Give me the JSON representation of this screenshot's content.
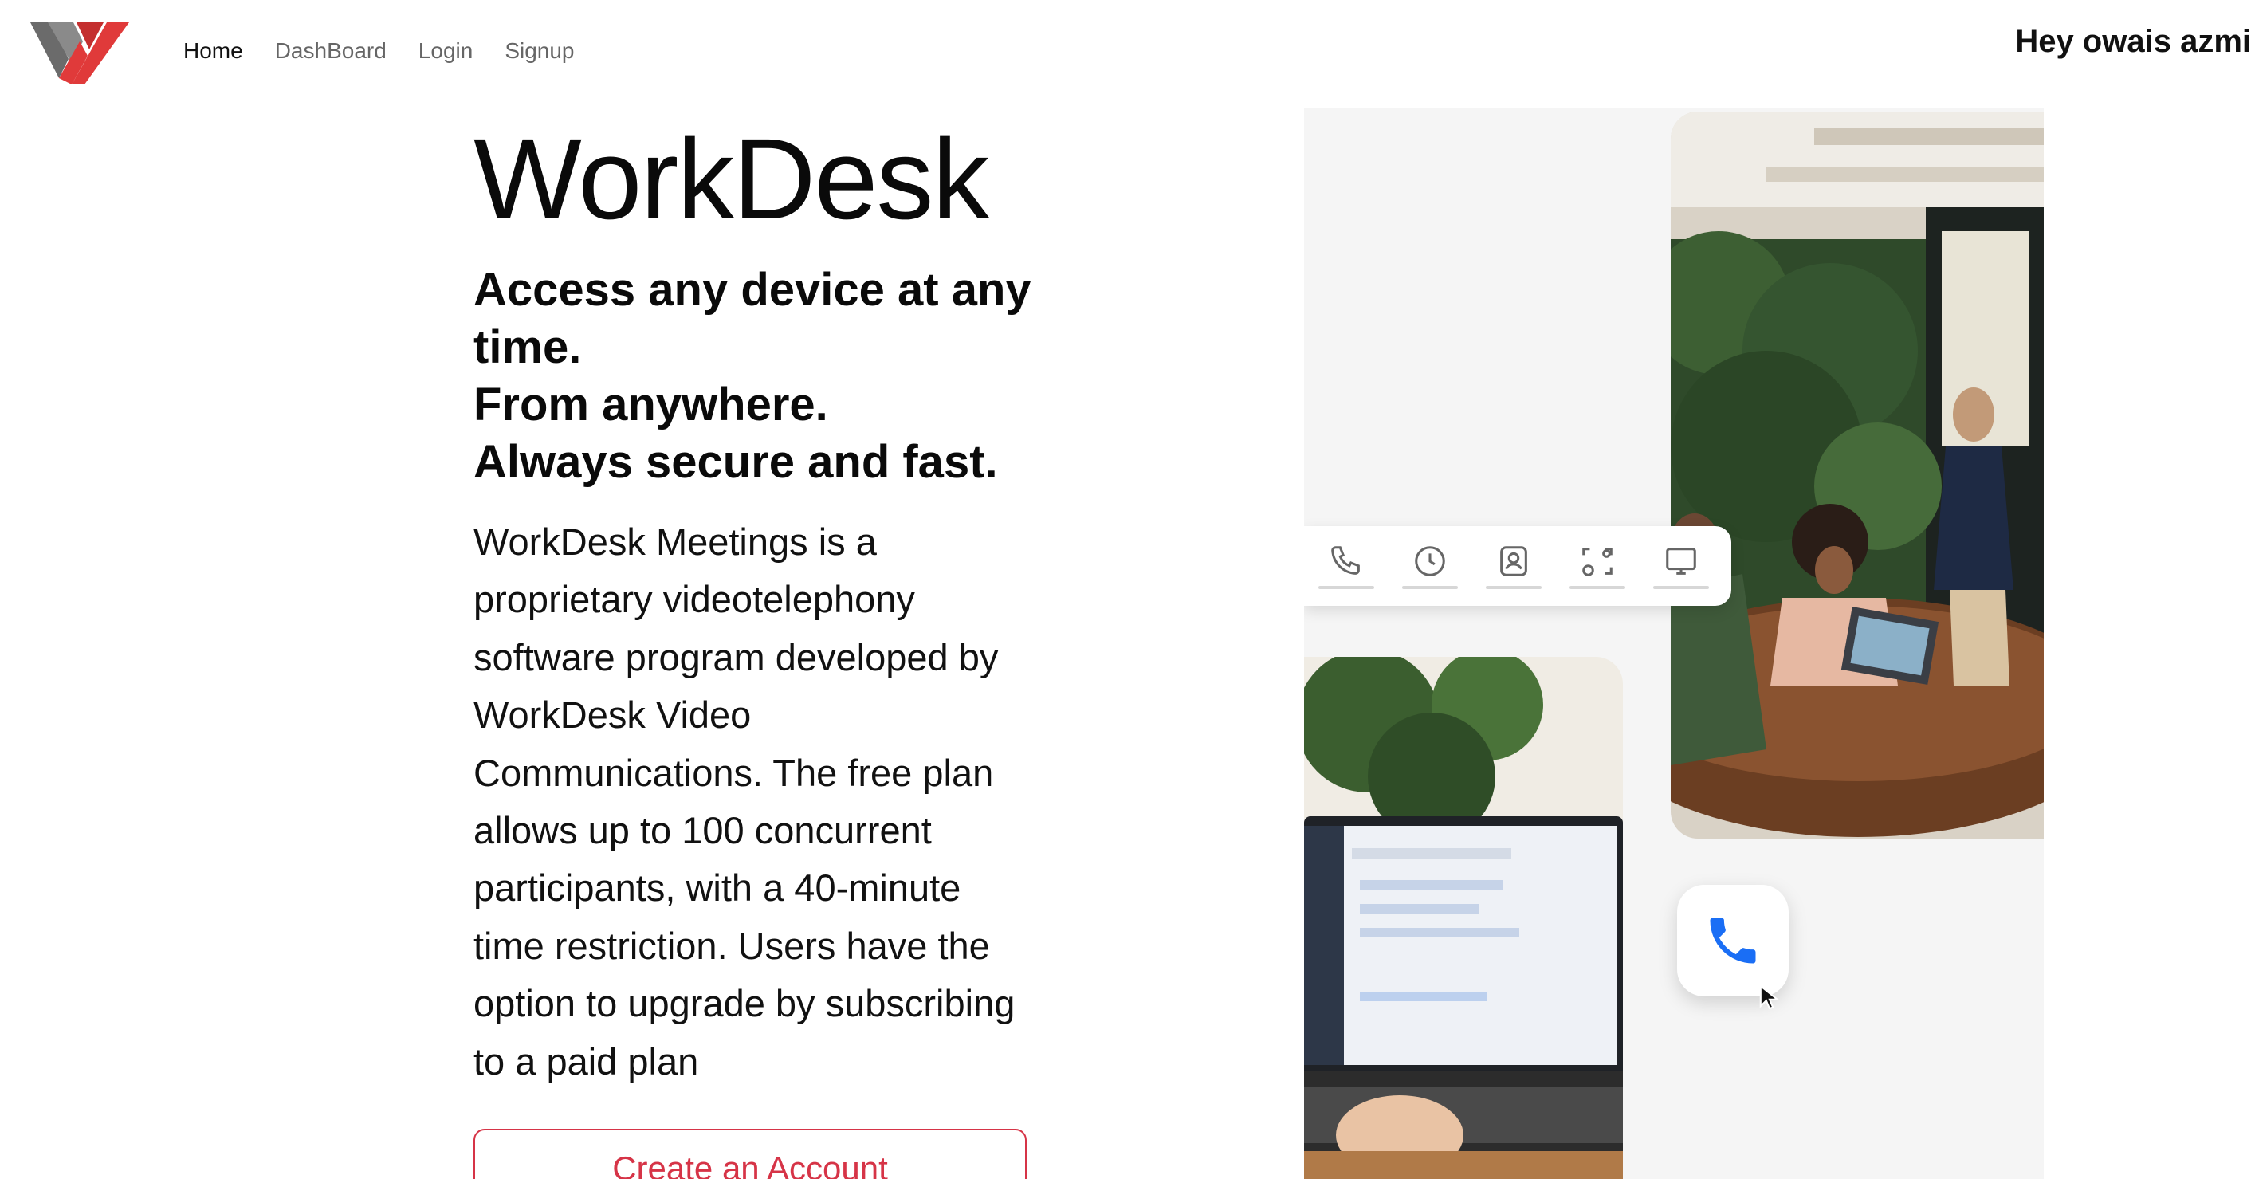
{
  "nav": {
    "logo_icon": "workdesk-logo-icon",
    "links": [
      {
        "label": "Home",
        "active": true
      },
      {
        "label": "DashBoard",
        "active": false
      },
      {
        "label": "Login",
        "active": false
      },
      {
        "label": "Signup",
        "active": false
      }
    ],
    "greeting": "Hey owais azmi"
  },
  "hero": {
    "title": "WorkDesk",
    "tagline": [
      "Access any device at any time.",
      "From anywhere.",
      "Always secure and fast."
    ],
    "description": "WorkDesk Meetings is a proprietary videotelephony software program developed by WorkDesk Video Communications. The free plan allows up to 100 concurrent participants, with a 40-minute time restriction. Users have the option to upgrade by subscribing to a paid plan",
    "cta_label": "Create an Account"
  },
  "illustration": {
    "toolbar_icons": [
      "phone-icon",
      "clock-icon",
      "contact-icon",
      "screen-share-icon",
      "monitor-icon"
    ],
    "call_button_icon": "phone-icon"
  },
  "colors": {
    "accent_red": "#d63447",
    "logo_gray": "#6b6b6b",
    "call_blue": "#1a6ef5"
  }
}
